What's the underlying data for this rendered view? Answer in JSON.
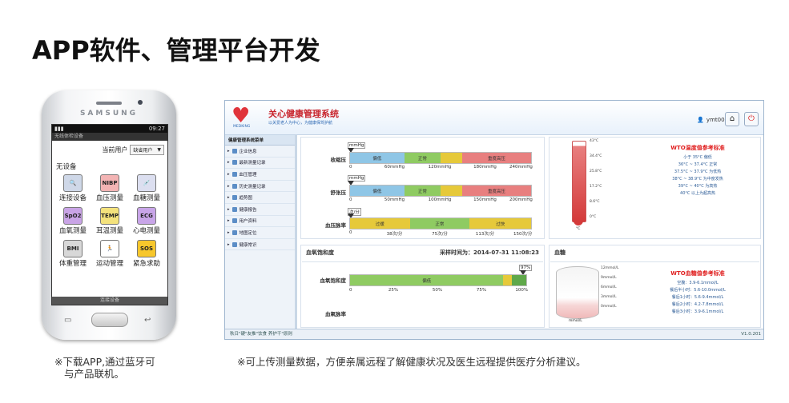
{
  "heading": "APP软件、管理平台开发",
  "captions": {
    "left_line1": "※下载APP,通过蓝牙可",
    "left_line2": "与产品联机。",
    "right": "※可上传测量数据，方便亲属远程了解健康状况及医生远程提供医疗分析建议。"
  },
  "phone": {
    "brand": "SAMSUNG",
    "status_time": "09:27",
    "app_title": "无线体检设备",
    "current_user_label": "当前用户",
    "current_user_value": "缺省用户",
    "no_device_label": "无设备",
    "icons": [
      {
        "label": "连接设备",
        "icon": "magnifier-icon",
        "glyph": "🔍",
        "color": "#cfd8e8"
      },
      {
        "label": "血压测量",
        "icon": "blood-pressure-icon",
        "glyph": "NIBP",
        "color": "#f3b4b4"
      },
      {
        "label": "血糖测量",
        "icon": "glucose-icon",
        "glyph": "💉",
        "color": "#dcdff0"
      },
      {
        "label": "血氧测量",
        "icon": "spo2-icon",
        "glyph": "SpO2",
        "color": "#c9a4e6"
      },
      {
        "label": "耳温测量",
        "icon": "temperature-icon",
        "glyph": "TEMP",
        "color": "#f4e27c"
      },
      {
        "label": "心电测量",
        "icon": "ecg-icon",
        "glyph": "ECG",
        "color": "#c8a5e8"
      },
      {
        "label": "体重管理",
        "icon": "bmi-icon",
        "glyph": "BMI",
        "color": "#d8d8d8"
      },
      {
        "label": "运动管理",
        "icon": "exercise-icon",
        "glyph": "🏃",
        "color": "#ffffff"
      },
      {
        "label": "紧急求助",
        "icon": "sos-icon",
        "glyph": "SOS",
        "color": "#f7c72c"
      }
    ],
    "bottom_bar": "连接设备"
  },
  "web": {
    "logo_title": "关心健康管理系统",
    "logo_sub": "以关爱老人为中心，为健康保驾护航",
    "logo_mark": "MEDKING",
    "user_name": "ymt001",
    "sidebar_header": "健康管理系统菜单",
    "sidebar_items": [
      "企业信息",
      "最新测量记录",
      "血压管理",
      "历史测量记录",
      "趋势图",
      "健康报告",
      "用户资料",
      "地图定位",
      "健康常识"
    ],
    "footer_text": "秋日\"硬\"友推\"饮食 养护干\"原则",
    "version": "V1.0.201",
    "bp": {
      "rows": [
        {
          "label": "收缩压",
          "unit": "mmHg",
          "segments": [
            "偏低",
            "正常",
            "",
            "重度高压"
          ],
          "ticks": [
            "0",
            "60mmHg",
            "120mmHg",
            "180mmHg",
            "240mmHg"
          ]
        },
        {
          "label": "舒张压",
          "unit": "mmHg",
          "segments": [
            "偏低",
            "正常",
            "",
            "重度高压"
          ],
          "ticks": [
            "0",
            "50mmHg",
            "100mmHg",
            "150mmHg",
            "200mmHg"
          ]
        },
        {
          "label": "血压脉率",
          "unit": "次/分",
          "segments": [
            "过缓",
            "正常",
            "过快"
          ],
          "ticks": [
            "0",
            "38次/分",
            "75次/分",
            "113次/分",
            "150次/分"
          ]
        }
      ]
    },
    "temperature_panel": {
      "ticks": [
        "43°C",
        "34.4°C",
        "25.8°C",
        "17.2°C",
        "8.6°C",
        "0°C"
      ],
      "unit": "°C",
      "ref_title": "WTO温度值参考标准",
      "ref_lines": [
        "小于 35°C 偏低",
        "36°C ~ 37.4°C 正常",
        "37.5°C ~ 37.9°C 为低热",
        "38°C ~ 38.9°C 为中度发热",
        "39°C ~ 40°C 为高热",
        "40°C 以上为超高热"
      ]
    },
    "spo2_panel": {
      "title": "血氧饱和度",
      "time_label": "采样时间为：",
      "time_value": "2014-07-31 11:08:23",
      "row_label": "血氧饱和度",
      "pulse_label": "血氧脉率",
      "value_badge": "97%",
      "segment_label": "偏低",
      "ticks": [
        "0",
        "25%",
        "50%",
        "75%",
        "100%"
      ]
    },
    "glucose_panel": {
      "title": "血糖",
      "unit": "mmol/L",
      "scale": [
        "12mmol/L",
        "9mmol/L",
        "6mmol/L",
        "3mmol/L",
        "0mmol/L"
      ],
      "ref_title": "WTO血糖值参考标准",
      "ref_lines": [
        "空腹：3.9-6.1mmol/L",
        "餐后半小时：5.6-10.0mmol/L",
        "餐后1小时：5.6-9.4mmol/L",
        "餐后2小时：4.2-7.8mmol/L",
        "餐后3小时：3.9-6.1mmol/L"
      ]
    }
  }
}
